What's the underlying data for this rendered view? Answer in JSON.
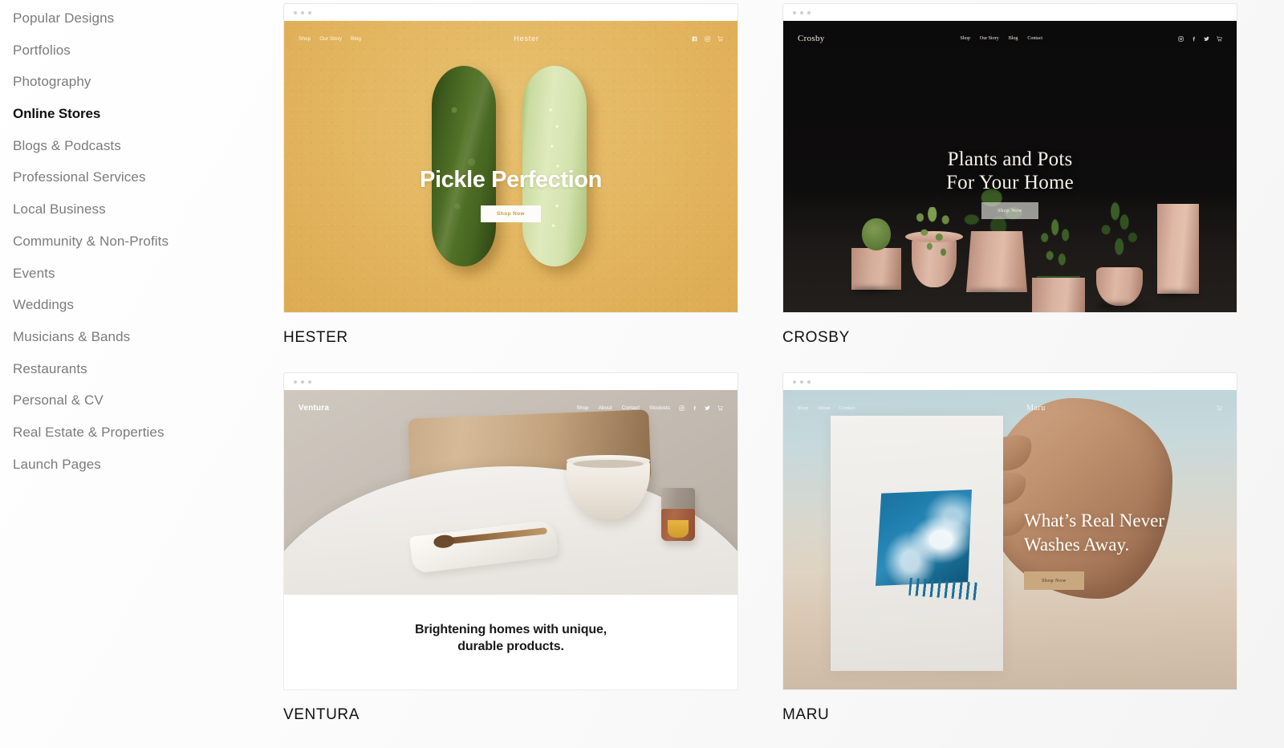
{
  "sidebar": {
    "items": [
      {
        "label": "Popular Designs",
        "active": false
      },
      {
        "label": "Portfolios",
        "active": false
      },
      {
        "label": "Photography",
        "active": false
      },
      {
        "label": "Online Stores",
        "active": true
      },
      {
        "label": "Blogs & Podcasts",
        "active": false
      },
      {
        "label": "Professional Services",
        "active": false
      },
      {
        "label": "Local Business",
        "active": false
      },
      {
        "label": "Community & Non-Profits",
        "active": false
      },
      {
        "label": "Events",
        "active": false
      },
      {
        "label": "Weddings",
        "active": false
      },
      {
        "label": "Musicians & Bands",
        "active": false
      },
      {
        "label": "Restaurants",
        "active": false
      },
      {
        "label": "Personal & CV",
        "active": false
      },
      {
        "label": "Real Estate & Properties",
        "active": false
      },
      {
        "label": "Launch Pages",
        "active": false
      }
    ]
  },
  "templates": [
    {
      "name": "HESTER",
      "logo": "Hester",
      "nav": [
        "Shop",
        "Our Story",
        "Blog"
      ],
      "icons": [
        "facebook-icon",
        "instagram-icon",
        "cart-icon"
      ],
      "hero_line1": "Pickle Perfection",
      "hero_line2": "",
      "cta": "Shop Now",
      "accent": "#e3b55f",
      "text_color": "#ffffff"
    },
    {
      "name": "CROSBY",
      "logo": "Crosby",
      "nav": [
        "Shop",
        "Our Story",
        "Blog",
        "Contact"
      ],
      "icons": [
        "instagram-icon",
        "facebook-icon",
        "twitter-icon",
        "cart-icon"
      ],
      "hero_line1": "Plants and Pots",
      "hero_line2": "For Your Home",
      "cta": "Shop Now",
      "accent": "#0d0c0c",
      "text_color": "#f4efe8"
    },
    {
      "name": "VENTURA",
      "logo": "Ventura",
      "nav": [
        "Shop",
        "About",
        "Contact",
        "Stockists"
      ],
      "icons": [
        "instagram-icon",
        "facebook-icon",
        "twitter-icon",
        "cart-icon"
      ],
      "hero_line1": "Brightening homes with unique,",
      "hero_line2": "durable products.",
      "cta": "",
      "accent": "#c4bbb2",
      "text_color": "#1a1a1a"
    },
    {
      "name": "MARU",
      "logo": "Maru",
      "nav": [
        "Shop",
        "About",
        "Contact"
      ],
      "icons": [
        "cart-icon"
      ],
      "hero_line1": "What’s Real Never",
      "hero_line2": "Washes Away.",
      "cta": "Shop Now",
      "accent": "#c9a880",
      "text_color": "#fffdf9"
    }
  ]
}
